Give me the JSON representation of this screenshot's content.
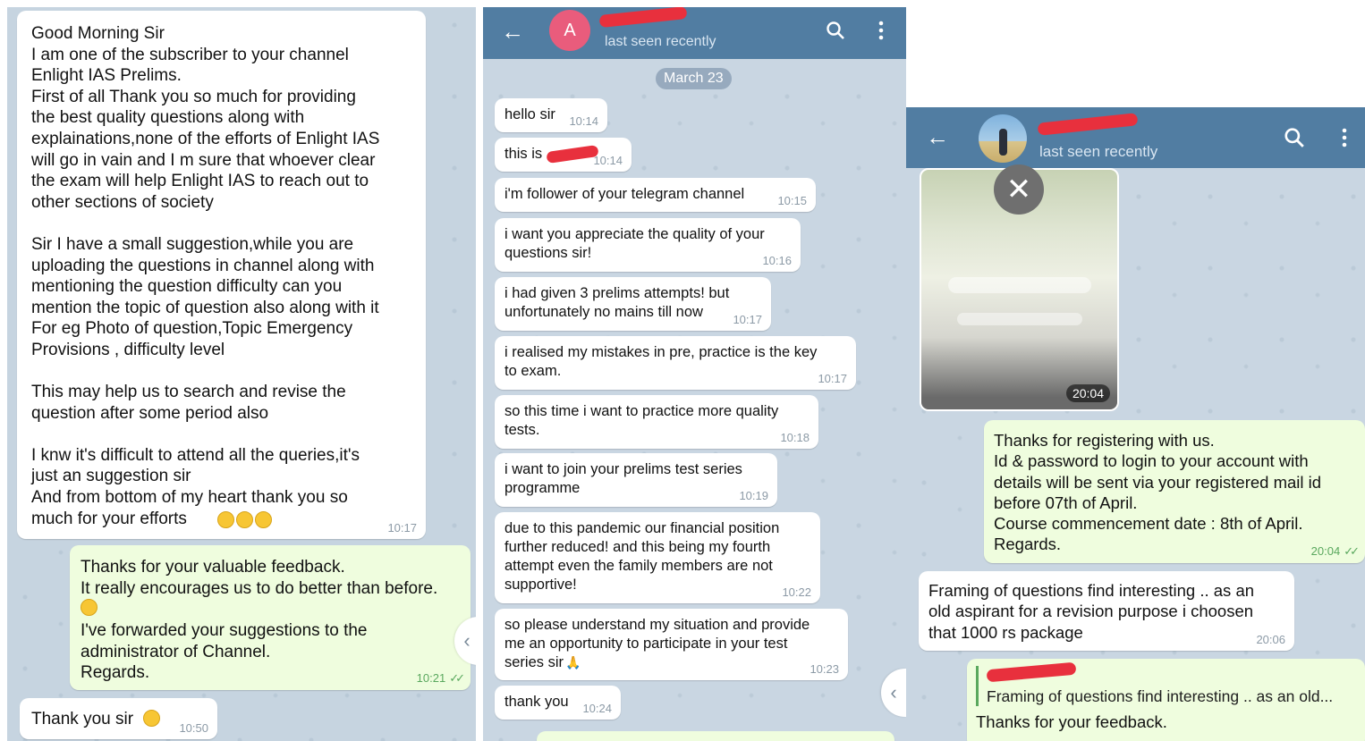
{
  "panel1": {
    "messages": [
      {
        "dir": "in",
        "text": "Good Morning Sir\nI am one of the subscriber to your channel\nEnlight IAS Prelims.\nFirst of all Thank you so much for providing\nthe best quality questions along with\nexplainations,none of the efforts of Enlight IAS\nwill go in vain and I m sure that whoever clear\nthe exam will help Enlight IAS to reach out to\nother sections of society\n\nSir I have a small suggestion,while you are\nuploading the questions in channel along with\nmentioning the question difficulty can you\nmention the topic of question also along with it\nFor eg Photo of question,Topic Emergency\nProvisions , difficulty level\n\nThis may help us to search and revise the\nquestion after some period also\n\nI knw it's difficult to attend all the queries,it's\njust an suggestion sir\nAnd from bottom of my heart thank you so\nmuch for your efforts",
        "time": "10:17"
      },
      {
        "dir": "out",
        "text_a": "Thanks for your valuable feedback.\nIt really encourages us to do better than before.",
        "text_b": "I've forwarded your suggestions to the\nadministrator of Channel.\nRegards.",
        "time": "10:21"
      },
      {
        "dir": "in",
        "text": "Thank you sir",
        "time": "10:50"
      }
    ],
    "side_arrow": "‹"
  },
  "panel2": {
    "header": {
      "avatar_letter": "A",
      "avatar_color": "#e95c7c",
      "status": "last seen recently",
      "search_icon": "search-icon",
      "menu_icon": "more-vert-icon"
    },
    "date_chip": "March 23",
    "messages": [
      {
        "text": "hello sir",
        "time": "10:14"
      },
      {
        "text": "this is",
        "time": "10:14"
      },
      {
        "text": "i'm follower of your telegram channel",
        "time": "10:15"
      },
      {
        "text": "i want you appreciate the quality of your\nquestions sir!",
        "time": "10:16"
      },
      {
        "text": "i had given 3 prelims attempts! but\nunfortunately no mains till now",
        "time": "10:17"
      },
      {
        "text": "i realised my mistakes in pre, practice is the key\nto exam.",
        "time": "10:17"
      },
      {
        "text": "so this time i want to practice more quality\ntests.",
        "time": "10:18"
      },
      {
        "text": "i want to join your prelims test series\nprogramme",
        "time": "10:19"
      },
      {
        "text": "due to this pandemic our financial position\nfurther reduced! and this being my fourth\nattempt even the family members are not\nsupportive!",
        "time": "10:22"
      },
      {
        "text": "so please understand my situation and provide\nme an opportunity to participate in your test\nseries sir",
        "time": "10:23"
      },
      {
        "text": "thank you",
        "time": "10:24"
      }
    ],
    "side_arrow": "‹"
  },
  "panel3": {
    "header": {
      "status": "last seen recently",
      "search_icon": "search-icon",
      "menu_icon": "more-vert-icon"
    },
    "photo": {
      "time": "20:04",
      "close_icon": "close-icon"
    },
    "messages": [
      {
        "dir": "out",
        "text": "Thanks for registering with us.\nId & password to login to your account with\ndetails will be sent via your registered mail id\nbefore 07th of April.\nCourse commencement date : 8th of April.\nRegards.",
        "time": "20:04"
      },
      {
        "dir": "in",
        "text": "Framing of questions find interesting .. as an\nold aspirant for a revision purpose i choosen\nthat 1000 rs package",
        "time": "20:06"
      },
      {
        "dir": "out",
        "reply_quote": "Framing of questions find interesting .. as an old...",
        "text": "Thanks for your feedback."
      }
    ]
  }
}
